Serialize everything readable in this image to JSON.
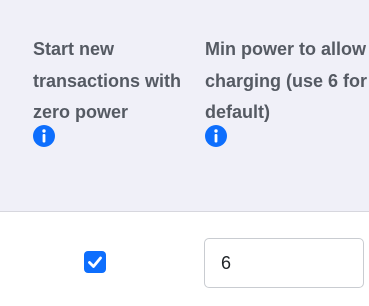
{
  "columns": {
    "zero_power": {
      "header": "Start new transactions with zero power",
      "info_icon": "info-icon"
    },
    "min_power": {
      "header": "Min power to allow charging (use 6 for default)",
      "info_icon": "info-icon"
    }
  },
  "row": {
    "zero_power_checked": true,
    "min_power_value": "6"
  },
  "colors": {
    "header_background": "#f0f0f8",
    "header_text": "#555a63",
    "accent": "#0d6efd",
    "divider": "#d7d7de",
    "input_border": "#c9ccd1"
  }
}
